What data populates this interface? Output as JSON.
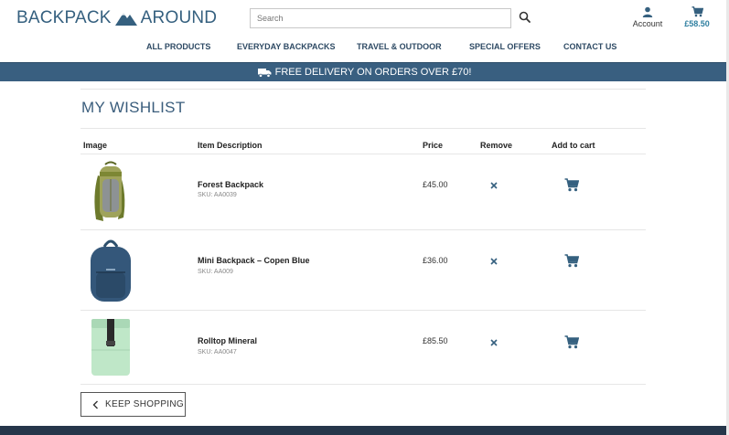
{
  "brand": {
    "name_left": "BACKPACK",
    "name_right": "AROUND",
    "color": "#35607f"
  },
  "search": {
    "placeholder": "Search"
  },
  "header": {
    "account_label": "Account",
    "cart_total": "£58.50"
  },
  "nav": {
    "items": [
      "ALL PRODUCTS",
      "EVERYDAY BACKPACKS",
      "TRAVEL & OUTDOOR",
      "SPECIAL OFFERS",
      "CONTACT US"
    ]
  },
  "banner": {
    "text": "FREE DELIVERY ON ORDERS OVER £70!",
    "background": "#395f80"
  },
  "wishlist": {
    "title": "MY WISHLIST",
    "columns": [
      "Image",
      "Item Description",
      "Price",
      "Remove",
      "Add to cart"
    ],
    "items": [
      {
        "name": "Forest Backpack",
        "sku": "SKU: AA0039",
        "price": "£45.00",
        "image_icon": "olive-hiking-backpack"
      },
      {
        "name": "Mini Backpack – Copen Blue",
        "sku": "SKU: AA009",
        "price": "£36.00",
        "image_icon": "blue-mini-backpack"
      },
      {
        "name": "Rolltop Mineral",
        "sku": "SKU: AA0047",
        "price": "£85.50",
        "image_icon": "mint-rolltop-backpack"
      }
    ]
  },
  "keep_shopping": {
    "label": "KEEP SHOPPING"
  },
  "colors": {
    "accent": "#3a5d7c",
    "cart_text": "#2f7fa0",
    "footer": "#26364a"
  }
}
